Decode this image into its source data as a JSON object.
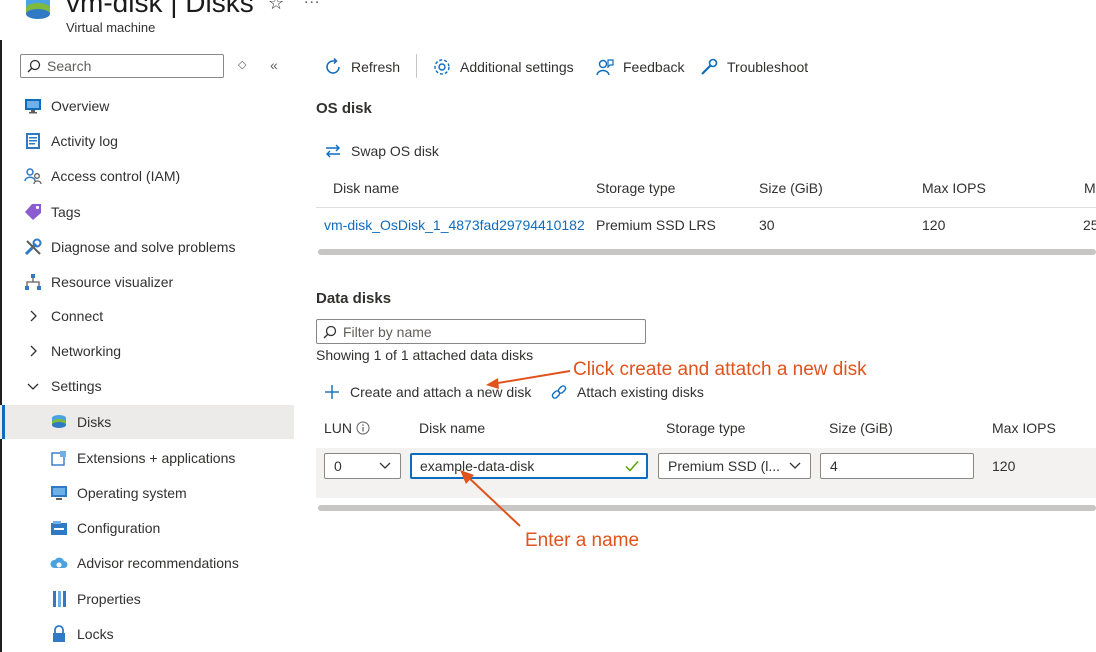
{
  "header": {
    "title": "vm-disk | Disks",
    "subtitle": "Virtual machine",
    "favorite_icon": "star-icon",
    "more_label": "..."
  },
  "sidebar": {
    "search_placeholder": "Search",
    "items": [
      {
        "label": "Overview",
        "icon": "monitor-icon"
      },
      {
        "label": "Activity log",
        "icon": "log-icon"
      },
      {
        "label": "Access control (IAM)",
        "icon": "people-icon"
      },
      {
        "label": "Tags",
        "icon": "tag-icon"
      },
      {
        "label": "Diagnose and solve problems",
        "icon": "wrench-icon"
      },
      {
        "label": "Resource visualizer",
        "icon": "hierarchy-icon"
      },
      {
        "label": "Connect",
        "icon": "chevron-right-icon"
      },
      {
        "label": "Networking",
        "icon": "chevron-right-icon"
      },
      {
        "label": "Settings",
        "icon": "chevron-down-icon"
      },
      {
        "label": "Disks",
        "icon": "disk-icon",
        "selected": true
      },
      {
        "label": "Extensions + applications",
        "icon": "extension-icon"
      },
      {
        "label": "Operating system",
        "icon": "os-icon"
      },
      {
        "label": "Configuration",
        "icon": "configuration-icon"
      },
      {
        "label": "Advisor recommendations",
        "icon": "advisor-icon"
      },
      {
        "label": "Properties",
        "icon": "properties-icon"
      },
      {
        "label": "Locks",
        "icon": "lock-icon"
      }
    ]
  },
  "toolbar": {
    "refresh": "Refresh",
    "additional_settings": "Additional settings",
    "feedback": "Feedback",
    "troubleshoot": "Troubleshoot"
  },
  "os_disk": {
    "title": "OS disk",
    "swap_label": "Swap OS disk",
    "columns": [
      "Disk name",
      "Storage type",
      "Size (GiB)",
      "Max IOPS",
      "M"
    ],
    "row": {
      "disk_name": "vm-disk_OsDisk_1_4873fad29794410182",
      "storage_type": "Premium SSD LRS",
      "size": "30",
      "max_iops": "120",
      "partial": "25"
    }
  },
  "data_disks": {
    "title": "Data disks",
    "filter_placeholder": "Filter by name",
    "showing_text": "Showing 1 of 1 attached data disks",
    "create_label": "Create and attach a new disk",
    "attach_label": "Attach existing disks",
    "columns": [
      "LUN",
      "Disk name",
      "Storage type",
      "Size (GiB)",
      "Max IOPS"
    ],
    "row": {
      "lun": "0",
      "disk_name": "example-data-disk",
      "storage_type": "Premium SSD (l...",
      "size": "4",
      "max_iops": "120"
    }
  },
  "annotations": {
    "create": "Click create and attatch a new disk",
    "name": "Enter a name",
    "color": "#e0531d"
  },
  "colors": {
    "accent": "#0f6cbd",
    "selected_bg": "#edebe9"
  }
}
